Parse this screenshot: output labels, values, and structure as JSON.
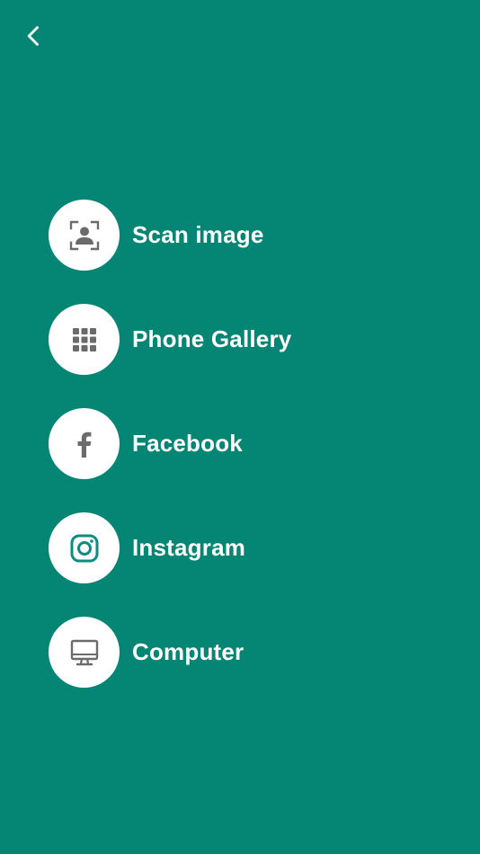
{
  "header": {
    "back_icon": "chevron-left-icon"
  },
  "colors": {
    "background": "#058573",
    "icon_circle": "#ffffff",
    "icon_gray": "#6b6b6b",
    "instagram_teal": "#0f8c80",
    "label_text": "#ffffff"
  },
  "sources": [
    {
      "label": "Scan image",
      "icon": "scan-person-icon"
    },
    {
      "label": "Phone Gallery",
      "icon": "grid-dots-icon"
    },
    {
      "label": "Facebook",
      "icon": "facebook-icon"
    },
    {
      "label": "Instagram",
      "icon": "instagram-icon"
    },
    {
      "label": "Computer",
      "icon": "monitor-icon"
    }
  ]
}
